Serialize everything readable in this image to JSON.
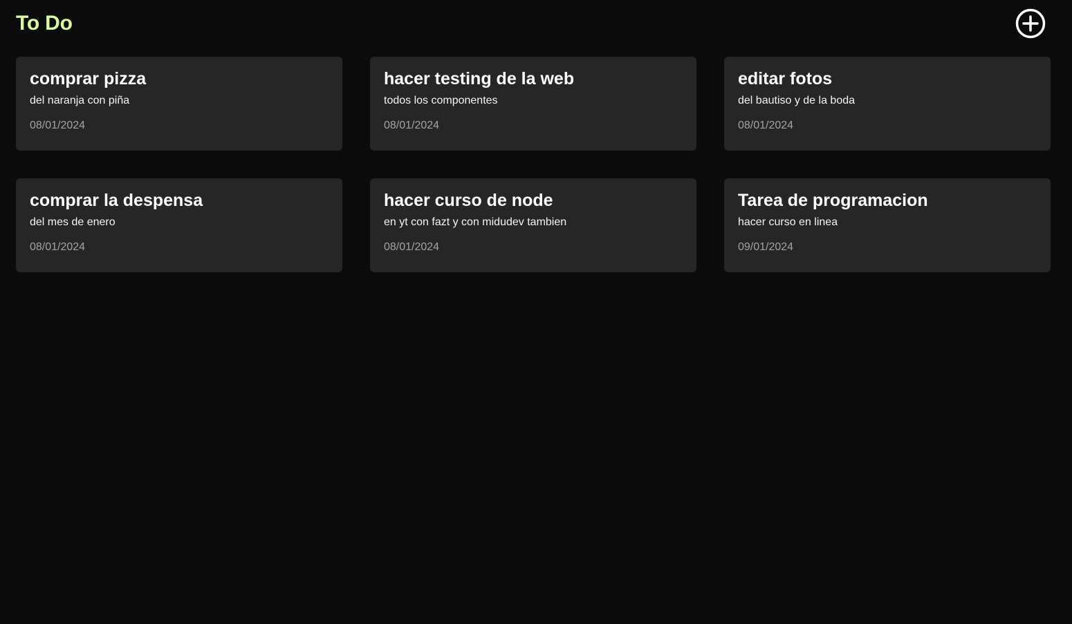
{
  "header": {
    "title": "To Do",
    "add_icon": "plus-circle-icon"
  },
  "colors": {
    "background": "#0b0b0b",
    "card_background": "#262626",
    "title_accent": "#d9f99d",
    "date_text": "#a3a3a3"
  },
  "tasks": [
    {
      "title": "comprar pizza",
      "description": "del naranja con piña",
      "date": "08/01/2024"
    },
    {
      "title": "hacer testing de la web",
      "description": "todos los componentes",
      "date": "08/01/2024"
    },
    {
      "title": "editar fotos",
      "description": "del bautiso y de la boda",
      "date": "08/01/2024"
    },
    {
      "title": "comprar la despensa",
      "description": "del mes de enero",
      "date": "08/01/2024"
    },
    {
      "title": "hacer curso de node",
      "description": "en yt con fazt y con midudev tambien",
      "date": "08/01/2024"
    },
    {
      "title": "Tarea de programacion",
      "description": "hacer curso en linea",
      "date": "09/01/2024"
    }
  ]
}
